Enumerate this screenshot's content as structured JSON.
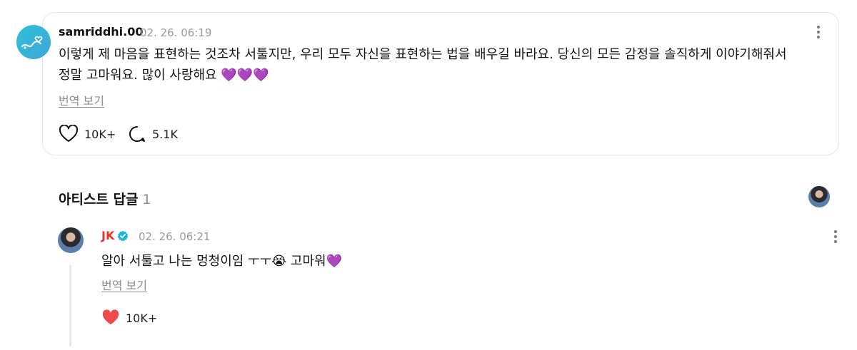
{
  "comment": {
    "username": "samriddhi.00",
    "timestamp": "02. 26. 06:19",
    "text_line1": "이렇게 제 마음을 표현하는 것조차 서툴지만, 우리 모두 자신을 표현하는 법을 배우길 바라요. 당신의 모든 감정을 솔직하게 이야기해줘서",
    "text_line2": "정말 고마워요. 많이 사랑해요 ",
    "hearts": "💜💜💜",
    "translate_label": "번역 보기",
    "likes": "10K+",
    "replies": "5.1K"
  },
  "artist_section": {
    "title": "아티스트 답글",
    "count": "1"
  },
  "reply": {
    "name": "JK",
    "timestamp": "02. 26. 06:21",
    "text": "알아 서툴고 나는 멍청이임 ㅜㅜ😭 고마워",
    "heart": "💜",
    "translate_label": "번역 보기",
    "likes": "10K+"
  },
  "colors": {
    "accent_artist": "#e8322a",
    "verified": "#19b6d8",
    "purple_heart": "#9b3fe0",
    "like_heart": "#ef4a4a"
  },
  "icons": [
    "heart-outline-icon",
    "comment-icon",
    "kebab-menu-icon",
    "verified-badge-icon",
    "heart-filled-icon"
  ]
}
